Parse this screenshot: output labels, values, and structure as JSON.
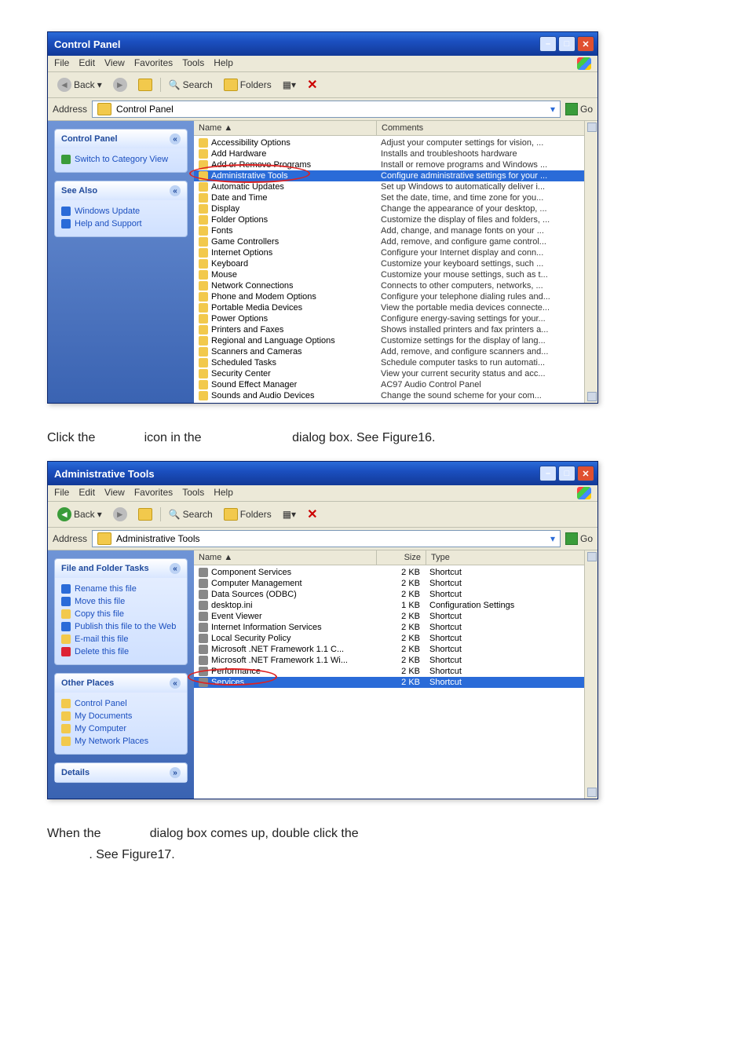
{
  "fig1": {
    "title": "Control Panel",
    "menu": [
      "File",
      "Edit",
      "View",
      "Favorites",
      "Tools",
      "Help"
    ],
    "toolbar": {
      "back": "Back",
      "search": "Search",
      "folders": "Folders"
    },
    "address_label": "Address",
    "address_value": "Control Panel",
    "go": "Go",
    "side": {
      "panel_title": "Control Panel",
      "switch": "Switch to Category View",
      "see_also": "See Also",
      "see_items": [
        "Windows Update",
        "Help and Support"
      ]
    },
    "cols": {
      "name": "Name  ▲",
      "comments": "Comments"
    },
    "items": [
      {
        "n": "Accessibility Options",
        "c": "Adjust your computer settings for vision, ..."
      },
      {
        "n": "Add Hardware",
        "c": "Installs and troubleshoots hardware"
      },
      {
        "n": "Add or Remove Programs",
        "c": "Install or remove programs and Windows ..."
      },
      {
        "n": "Administrative Tools",
        "c": "Configure administrative settings for your ...",
        "sel": true
      },
      {
        "n": "Automatic Updates",
        "c": "Set up Windows to automatically deliver i..."
      },
      {
        "n": "Date and Time",
        "c": "Set the date, time, and time zone for you..."
      },
      {
        "n": "Display",
        "c": "Change the appearance of your desktop, ..."
      },
      {
        "n": "Folder Options",
        "c": "Customize the display of files and folders, ..."
      },
      {
        "n": "Fonts",
        "c": "Add, change, and manage fonts on your ..."
      },
      {
        "n": "Game Controllers",
        "c": "Add, remove, and configure game control..."
      },
      {
        "n": "Internet Options",
        "c": "Configure your Internet display and conn..."
      },
      {
        "n": "Keyboard",
        "c": "Customize your keyboard settings, such ..."
      },
      {
        "n": "Mouse",
        "c": "Customize your mouse settings, such as t..."
      },
      {
        "n": "Network Connections",
        "c": "Connects to other computers, networks, ..."
      },
      {
        "n": "Phone and Modem Options",
        "c": "Configure your telephone dialing rules and..."
      },
      {
        "n": "Portable Media Devices",
        "c": "View the portable media devices connecte..."
      },
      {
        "n": "Power Options",
        "c": "Configure energy-saving settings for your..."
      },
      {
        "n": "Printers and Faxes",
        "c": "Shows installed printers and fax printers a..."
      },
      {
        "n": "Regional and Language Options",
        "c": "Customize settings for the display of lang..."
      },
      {
        "n": "Scanners and Cameras",
        "c": "Add, remove, and configure scanners and..."
      },
      {
        "n": "Scheduled Tasks",
        "c": "Schedule computer tasks to run automati..."
      },
      {
        "n": "Security Center",
        "c": "View your current security status and acc..."
      },
      {
        "n": "Sound Effect Manager",
        "c": "AC97 Audio Control Panel"
      },
      {
        "n": "Sounds and Audio Devices",
        "c": "Change the sound scheme for your com..."
      }
    ]
  },
  "instr1": {
    "a": "Click the ",
    "b": " icon in the ",
    "c": " dialog box. See Figure16."
  },
  "fig2": {
    "title": "Administrative Tools",
    "menu": [
      "File",
      "Edit",
      "View",
      "Favorites",
      "Tools",
      "Help"
    ],
    "toolbar": {
      "back": "Back",
      "search": "Search",
      "folders": "Folders"
    },
    "address_label": "Address",
    "address_value": "Administrative Tools",
    "go": "Go",
    "side": {
      "tasks_title": "File and Folder Tasks",
      "tasks": [
        "Rename this file",
        "Move this file",
        "Copy this file",
        "Publish this file to the Web",
        "E-mail this file",
        "Delete this file"
      ],
      "places_title": "Other Places",
      "places": [
        "Control Panel",
        "My Documents",
        "My Computer",
        "My Network Places"
      ],
      "details_title": "Details"
    },
    "cols": {
      "name": "Name  ▲",
      "size": "Size",
      "type": "Type"
    },
    "items": [
      {
        "n": "Component Services",
        "s": "2 KB",
        "t": "Shortcut"
      },
      {
        "n": "Computer Management",
        "s": "2 KB",
        "t": "Shortcut"
      },
      {
        "n": "Data Sources (ODBC)",
        "s": "2 KB",
        "t": "Shortcut"
      },
      {
        "n": "desktop.ini",
        "s": "1 KB",
        "t": "Configuration Settings"
      },
      {
        "n": "Event Viewer",
        "s": "2 KB",
        "t": "Shortcut"
      },
      {
        "n": "Internet Information Services",
        "s": "2 KB",
        "t": "Shortcut"
      },
      {
        "n": "Local Security Policy",
        "s": "2 KB",
        "t": "Shortcut"
      },
      {
        "n": "Microsoft .NET Framework 1.1 C...",
        "s": "2 KB",
        "t": "Shortcut"
      },
      {
        "n": "Microsoft .NET Framework 1.1 Wi...",
        "s": "2 KB",
        "t": "Shortcut"
      },
      {
        "n": "Performance",
        "s": "2 KB",
        "t": "Shortcut"
      },
      {
        "n": "Services",
        "s": "2 KB",
        "t": "Shortcut",
        "sel": true
      }
    ]
  },
  "instr2": {
    "a": "When the ",
    "b": " dialog box comes up, double click the ",
    "c": ". See Figure17."
  }
}
